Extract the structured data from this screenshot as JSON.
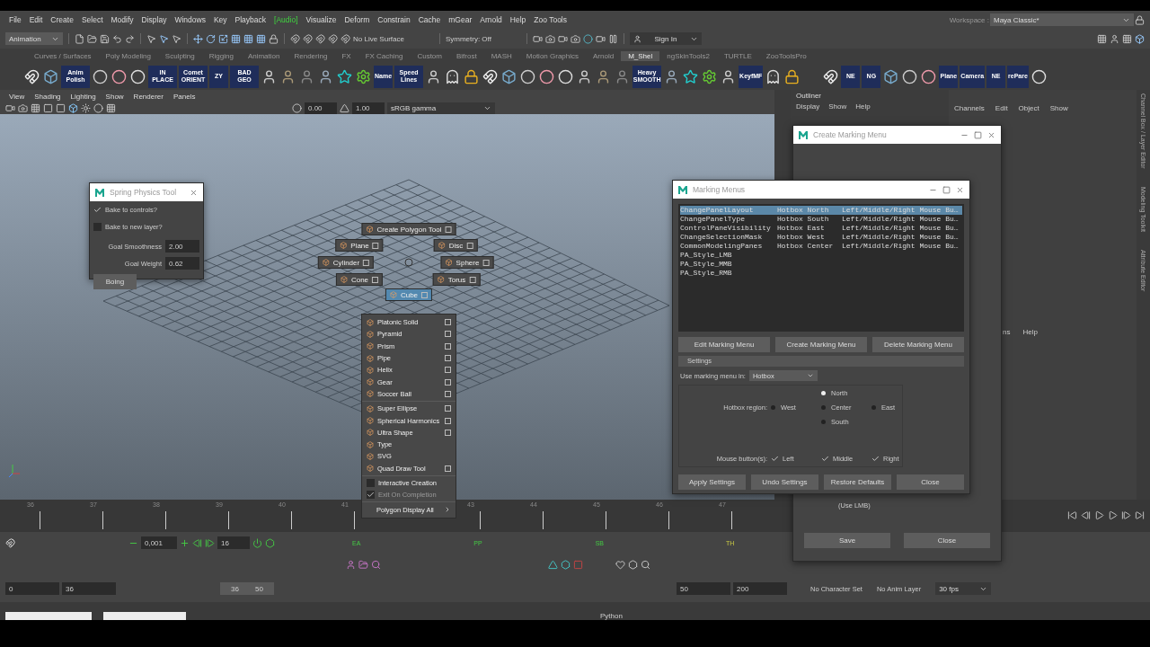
{
  "menubar": {
    "items": [
      {
        "label": "File",
        "kind": "menu"
      },
      {
        "label": "Edit",
        "kind": "menu"
      },
      {
        "label": "Create",
        "kind": "menu"
      },
      {
        "label": "Select",
        "kind": "menu"
      },
      {
        "label": "Modify",
        "kind": "menu"
      },
      {
        "label": "Display",
        "kind": "menu"
      },
      {
        "label": "Windows",
        "kind": "menu"
      },
      {
        "label": "Key",
        "kind": "menu"
      },
      {
        "label": "Playback",
        "kind": "menu"
      },
      {
        "label": "[Audio]",
        "kind": "audio"
      },
      {
        "label": "Visualize",
        "kind": "menu"
      },
      {
        "label": "Deform",
        "kind": "menu"
      },
      {
        "label": "Constrain",
        "kind": "menu"
      },
      {
        "label": "Cache",
        "kind": "menu"
      },
      {
        "label": "mGear",
        "kind": "menu"
      },
      {
        "label": "Arnold",
        "kind": "menu"
      },
      {
        "label": "Help",
        "kind": "menu"
      },
      {
        "label": "Zoo Tools",
        "kind": "menu"
      }
    ],
    "workspace_label": "Workspace :",
    "workspace_value": "Maya Classic*"
  },
  "status_line": {
    "menu_set": "Animation",
    "live_surface": "No Live Surface",
    "symmetry": "Symmetry: Off",
    "sign_in": "Sign In"
  },
  "shelf": {
    "tabs": [
      {
        "label": "Curves / Surfaces",
        "selected": false
      },
      {
        "label": "Poly Modeling",
        "selected": false
      },
      {
        "label": "Sculpting",
        "selected": false
      },
      {
        "label": "Rigging",
        "selected": false
      },
      {
        "label": "Animation",
        "selected": false
      },
      {
        "label": "Rendering",
        "selected": false
      },
      {
        "label": "FX",
        "selected": false
      },
      {
        "label": "FX Caching",
        "selected": false
      },
      {
        "label": "Custom",
        "selected": false
      },
      {
        "label": "Bifrost",
        "selected": false
      },
      {
        "label": "MASH",
        "selected": false
      },
      {
        "label": "Motion Graphics",
        "selected": false
      },
      {
        "label": "Arnold",
        "selected": false
      },
      {
        "label": "M_Shel",
        "selected": true
      },
      {
        "label": "ngSkinTools2",
        "selected": false
      },
      {
        "label": "TURTLE",
        "selected": false
      },
      {
        "label": "ZooToolsPro",
        "selected": false
      }
    ],
    "items": [
      {
        "kind": "glyph"
      },
      {
        "kind": "glyph"
      },
      {
        "kind": "label",
        "label": "Anim Polish"
      },
      {
        "kind": "glyph"
      },
      {
        "kind": "glyph"
      },
      {
        "kind": "glyph"
      },
      {
        "kind": "label",
        "label": "IN PLACE"
      },
      {
        "kind": "label",
        "label": "Comet ORIENT"
      },
      {
        "kind": "label",
        "label": "ZY"
      },
      {
        "kind": "label",
        "label": "BAD GEO"
      },
      {
        "kind": "glyph"
      },
      {
        "kind": "glyph"
      },
      {
        "kind": "glyph"
      },
      {
        "kind": "glyph"
      },
      {
        "kind": "glyph"
      },
      {
        "kind": "glyph"
      },
      {
        "kind": "label",
        "label": "Name"
      },
      {
        "kind": "label",
        "label": "Speed Lines"
      },
      {
        "kind": "glyph"
      },
      {
        "kind": "glyph"
      },
      {
        "kind": "glyph"
      },
      {
        "kind": "glyph"
      },
      {
        "kind": "glyph"
      },
      {
        "kind": "glyph"
      },
      {
        "kind": "glyph"
      },
      {
        "kind": "glyph"
      },
      {
        "kind": "glyph"
      },
      {
        "kind": "glyph"
      },
      {
        "kind": "glyph"
      },
      {
        "kind": "label",
        "label": "Heavy SMOOTH"
      },
      {
        "kind": "glyph"
      },
      {
        "kind": "glyph"
      },
      {
        "kind": "glyph"
      },
      {
        "kind": "glyph"
      },
      {
        "kind": "label",
        "label": "KeyfMF"
      },
      {
        "kind": "glyph"
      },
      {
        "kind": "glyph"
      },
      {
        "kind": "spacer"
      },
      {
        "kind": "glyph"
      },
      {
        "kind": "label",
        "label": "NE"
      },
      {
        "kind": "label",
        "label": "NG"
      },
      {
        "kind": "glyph"
      },
      {
        "kind": "glyph"
      },
      {
        "kind": "glyph"
      },
      {
        "kind": "label",
        "label": "Plane"
      },
      {
        "kind": "label",
        "label": "Camera"
      },
      {
        "kind": "label",
        "label": "NE"
      },
      {
        "kind": "label",
        "label": "rePare"
      },
      {
        "kind": "glyph"
      }
    ]
  },
  "viewport": {
    "menus": [
      "View",
      "Shading",
      "Lighting",
      "Show",
      "Renderer",
      "Panels"
    ],
    "exposure": "0.00",
    "gamma": "1.00",
    "color_space": "sRGB gamma"
  },
  "outliner": {
    "title": "Outliner",
    "menus": [
      "Display",
      "Show",
      "Help"
    ]
  },
  "channel_box": {
    "menus": [
      "Channels",
      "Edit",
      "Object",
      "Show"
    ],
    "side_tabs": [
      "Channel Box / Layer Editor",
      "Modeling Toolkit",
      "Attribute Editor"
    ],
    "layer_menus": [
      "ns",
      "Help"
    ]
  },
  "spring_tool": {
    "title": "Spring Physics Tool",
    "checkboxes": [
      {
        "label": "Bake to controls?",
        "checked": true
      },
      {
        "label": "Bake to new layer?",
        "checked": false
      }
    ],
    "fields": [
      {
        "label": "Goal Smoothness",
        "value": "2.00"
      },
      {
        "label": "Goal Weight",
        "value": "0.62"
      }
    ],
    "button": "Boing"
  },
  "marking_menu": {
    "radial": [
      {
        "label": "Create Polygon Tool",
        "selected": false
      },
      {
        "label": "Plane",
        "selected": false
      },
      {
        "label": "Disc",
        "selected": false
      },
      {
        "label": "Cylinder",
        "selected": false
      },
      {
        "label": "Sphere",
        "selected": false
      },
      {
        "label": "Cone",
        "selected": false
      },
      {
        "label": "Torus",
        "selected": false
      },
      {
        "label": "Cube",
        "selected": true
      }
    ],
    "list": [
      {
        "kind": "item",
        "label": "Platonic Solid",
        "option_box": true
      },
      {
        "kind": "item",
        "label": "Pyramid",
        "option_box": true
      },
      {
        "kind": "item",
        "label": "Prism",
        "option_box": true
      },
      {
        "kind": "item",
        "label": "Pipe",
        "option_box": true
      },
      {
        "kind": "item",
        "label": "Helix",
        "option_box": true
      },
      {
        "kind": "item",
        "label": "Gear",
        "option_box": true
      },
      {
        "kind": "item",
        "label": "Soccer Ball",
        "option_box": true
      },
      {
        "kind": "divider"
      },
      {
        "kind": "item",
        "label": "Super Ellipse",
        "option_box": true
      },
      {
        "kind": "item",
        "label": "Spherical Harmonics",
        "option_box": true
      },
      {
        "kind": "item",
        "label": "Ultra Shape",
        "option_box": true
      },
      {
        "kind": "item",
        "label": "Type",
        "option_box": false
      },
      {
        "kind": "item",
        "label": "SVG",
        "option_box": false
      },
      {
        "kind": "item",
        "label": "Quad Draw Tool",
        "option_box": true
      },
      {
        "kind": "divider"
      },
      {
        "kind": "check",
        "label": "Interactive Creation",
        "checked": false,
        "disabled": false
      },
      {
        "kind": "check",
        "label": "Exit On Completion",
        "checked": true,
        "disabled": true
      },
      {
        "kind": "divider"
      },
      {
        "kind": "submenu",
        "label": "Polygon Display All"
      }
    ]
  },
  "create_marking_menu": {
    "title": "Create Marking Menu",
    "hint": "(Use LMB)",
    "buttons": [
      "Save",
      "Close"
    ]
  },
  "marking_menus": {
    "title": "Marking Menus",
    "rows": [
      {
        "name": "ChangePanelLayout",
        "location": "Hotbox North",
        "buttons": "Left/Middle/Right Mouse Bu…",
        "selected": true
      },
      {
        "name": "ChangePanelType",
        "location": "Hotbox South",
        "buttons": "Left/Middle/Right Mouse Bu…",
        "selected": false
      },
      {
        "name": "ControlPaneVisibility",
        "location": "Hotbox East",
        "buttons": "Left/Middle/Right Mouse Bu…",
        "selected": false
      },
      {
        "name": "ChangeSelectionMask",
        "location": "Hotbox West",
        "buttons": "Left/Middle/Right Mouse Bu…",
        "selected": false
      },
      {
        "name": "CommonModelingPanes",
        "location": "Hotbox Center",
        "buttons": "Left/Middle/Right Mouse Bu…",
        "selected": false
      },
      {
        "name": "PA_Style_LMB",
        "selected": false
      },
      {
        "name": "PA_Style_MMB",
        "selected": false
      },
      {
        "name": "PA_Style_RMB",
        "selected": false
      }
    ],
    "actions": [
      "Edit Marking Menu",
      "Create Marking Menu",
      "Delete Marking Menu"
    ],
    "settings_label": "Settings",
    "use_in_label": "Use marking menu in:",
    "use_in_value": "Hotbox",
    "region_label": "Hotbox region:",
    "regions": [
      {
        "label": "North",
        "selected": true
      },
      {
        "label": "West",
        "selected": false
      },
      {
        "label": "Center",
        "selected": false
      },
      {
        "label": "East",
        "selected": false
      },
      {
        "label": "South",
        "selected": false
      }
    ],
    "mouse_label": "Mouse button(s):",
    "mouse_buttons": [
      {
        "label": "Left",
        "checked": true
      },
      {
        "label": "Middle",
        "checked": true
      },
      {
        "label": "Right",
        "checked": true
      }
    ],
    "footer": [
      "Apply Settings",
      "Undo Settings",
      "Restore Defaults",
      "Close"
    ]
  },
  "timeline": {
    "ticks": [
      "36",
      "37",
      "38",
      "39",
      "40",
      "41",
      "43",
      "44",
      "45",
      "46",
      "47"
    ]
  },
  "playback": {
    "step": "0,001",
    "frame": "16",
    "markers": [
      "EA",
      "PP",
      "SB",
      "TH"
    ]
  },
  "range": {
    "start": "0",
    "inner_start": "36",
    "slider_start": "36",
    "slider_end": "50",
    "inner_end": "50",
    "end": "200",
    "character": "No Character Set",
    "anim_layer": "No Anim Layer",
    "fps": "30 fps"
  },
  "command_line": {
    "language": "Python"
  }
}
